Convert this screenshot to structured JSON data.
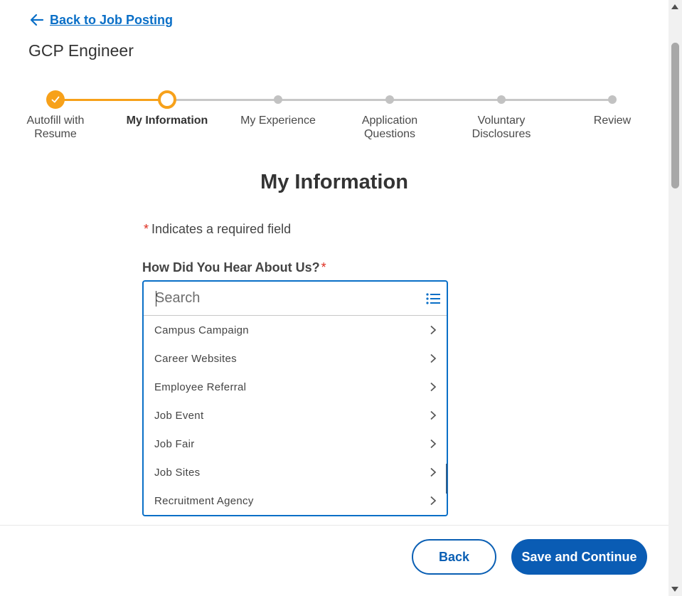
{
  "nav": {
    "back_link": "Back to Job Posting"
  },
  "job": {
    "title": "GCP Engineer"
  },
  "stepper": {
    "steps": [
      {
        "label": "Autofill with\nResume",
        "state": "done"
      },
      {
        "label": "My Information",
        "state": "current"
      },
      {
        "label": "My Experience",
        "state": "todo"
      },
      {
        "label": "Application\nQuestions",
        "state": "todo"
      },
      {
        "label": "Voluntary\nDisclosures",
        "state": "todo"
      },
      {
        "label": "Review",
        "state": "todo"
      }
    ]
  },
  "section": {
    "title": "My Information"
  },
  "required_note": {
    "star": "*",
    "text": "Indicates a required field"
  },
  "field": {
    "label": "How Did You Hear About Us?",
    "star": "*",
    "search_placeholder": "Search",
    "search_value": "",
    "options": [
      "Campus Campaign",
      "Career Websites",
      "Employee Referral",
      "Job Event",
      "Job Fair",
      "Job Sites",
      "Recruitment Agency"
    ]
  },
  "footer": {
    "back_label": "Back",
    "primary_label": "Save and Continue"
  },
  "colors": {
    "accent": "#0a6fc7",
    "progress": "#f7a11a",
    "required": "#de2e21",
    "primary_button": "#0a5cb4"
  }
}
